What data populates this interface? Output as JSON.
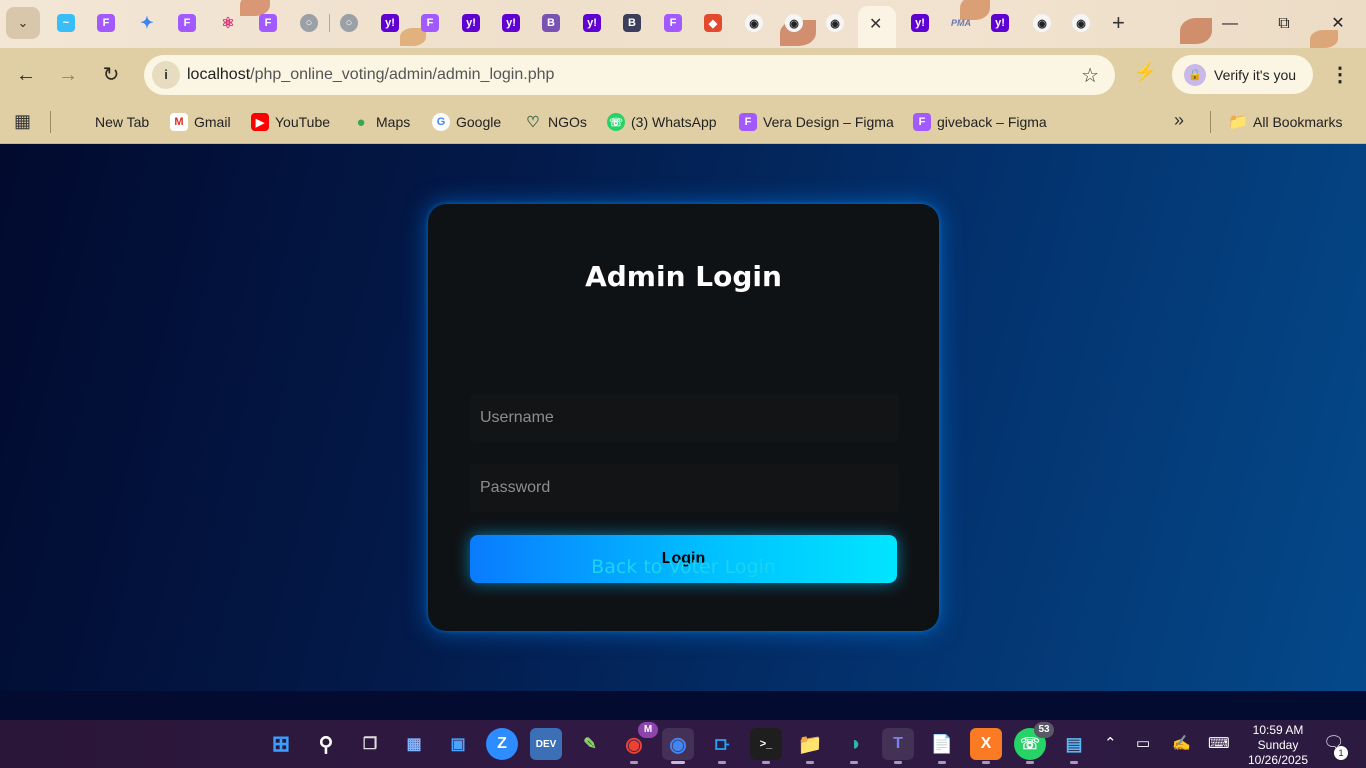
{
  "browser": {
    "address_host": "localhost",
    "address_path": "/php_online_voting/admin/admin_login.php",
    "verify_label": "Verify it's you",
    "tabs_favicons": [
      "tailwind",
      "figma",
      "gemini",
      "figma",
      "react",
      "figma",
      "globe",
      "globe",
      "yahoo",
      "figma",
      "yahoo",
      "yahoo",
      "bootstrap",
      "yahoo",
      "bootstrap",
      "figma",
      "brave",
      "github",
      "github",
      "github",
      "close",
      "yahoo",
      "phpmyadmin",
      "yahoo",
      "github",
      "github"
    ],
    "pma_label": "PMA",
    "yahoo_glyph": "y!",
    "bootstrap_glyph": "B"
  },
  "bookmarks": {
    "items": [
      {
        "label": "New Tab",
        "icon": "none"
      },
      {
        "label": "Gmail",
        "icon": "gmail-icon"
      },
      {
        "label": "YouTube",
        "icon": "youtube-icon"
      },
      {
        "label": "Maps",
        "icon": "maps-icon"
      },
      {
        "label": "Google",
        "icon": "google-icon"
      },
      {
        "label": "NGOs",
        "icon": "heart-icon"
      },
      {
        "label": "(3) WhatsApp",
        "icon": "whatsapp-icon"
      },
      {
        "label": "Vera Design – Figma",
        "icon": "figma-icon"
      },
      {
        "label": "giveback – Figma",
        "icon": "figma-icon"
      }
    ],
    "all_bookmarks": "All Bookmarks"
  },
  "login": {
    "title": "Admin Login",
    "username_placeholder": "Username",
    "password_placeholder": "Password",
    "login_button": "Login",
    "back_link": "Back to Voter Login"
  },
  "taskbar": {
    "whatsapp_badge": "53",
    "chrome_profile_badge": "M",
    "time": "10:59 AM",
    "day": "Sunday",
    "date": "10/26/2025",
    "notification_count": "1"
  },
  "colors": {
    "accent_cyan": "#19d3f0",
    "button_gradient_start": "#0a7bff",
    "button_gradient_end": "#00e5ff",
    "card_bg": "#0f1215"
  }
}
